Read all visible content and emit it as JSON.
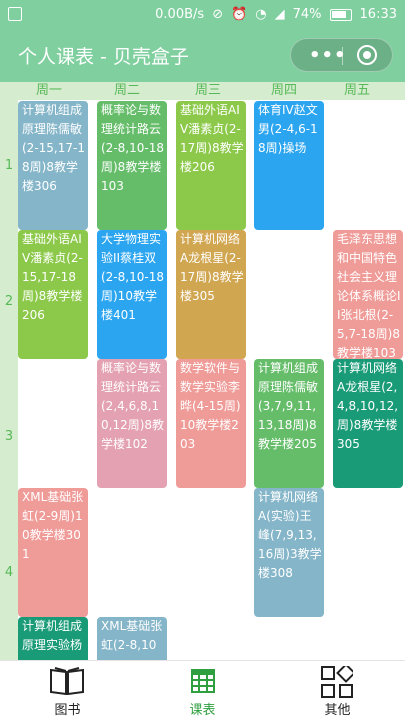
{
  "status_bar": {
    "speed": "0.00B/s",
    "battery": "74%",
    "time": "16:33"
  },
  "title": "个人课表 - 贝壳盒子",
  "days": [
    "周一",
    "周二",
    "周三",
    "周四",
    "周五"
  ],
  "periods": [
    "1",
    "2",
    "3",
    "4"
  ],
  "courses": {
    "c1": "计算机组成原理陈儒敏(2-15,17-18周)8教学楼306",
    "c2": "概率论与数理统计路云(2-8,10-18周)8教学楼103",
    "c3": "基础外语AIV潘素贞(2-17周)8教学楼206",
    "c4": "体育IV赵文男(2-4,6-18周)操场",
    "c5": "基础外语AIV潘素贞(2-15,17-18周)8教学楼206",
    "c6": "大学物理实验II蔡桂双(2-8,10-18周)10教学楼401",
    "c7": "计算机网络A龙根星(2-17周)8教学楼305",
    "c8": "毛泽东思想和中国特色社会主义理论体系概论II张北根(2-5,7-18周)8教学楼103",
    "c9": "概率论与数理统计路云(2,4,6,8,10,12周)8教学楼102",
    "c10": "数学软件与数学实验李晔(4-15周)10教学楼203",
    "c11": "计算机组成原理陈儒敏(3,7,9,11,13,18周)8教学楼205",
    "c12": "计算机网络A龙根星(2,4,8,10,12,周)8教学楼305",
    "c13": "XML基础张虹(2-9周)10教学楼301",
    "c14": "计算机网络A(实验)王峰(7,9,13,16周)3教学楼308",
    "c15": "计算机组成原理实验杨",
    "c16": "XML基础张虹(2-8,10"
  },
  "tabs": {
    "books": "图书",
    "schedule": "课表",
    "other": "其他"
  },
  "colors": {
    "primary": "#7fcf9f",
    "active": "#2f9f40"
  }
}
